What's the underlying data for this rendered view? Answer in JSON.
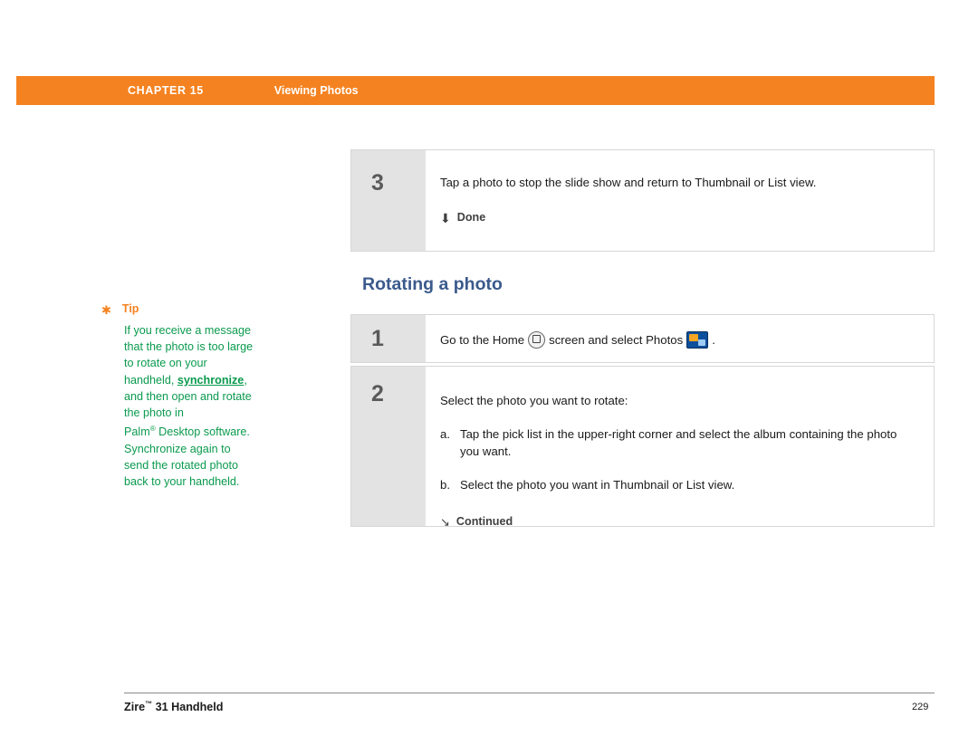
{
  "header": {
    "chapter": "CHAPTER 15",
    "section": "Viewing Photos"
  },
  "tip": {
    "label": "Tip",
    "star_icon": "asterisk-icon",
    "line1": "If you receive a message",
    "line2": "that the photo is too large",
    "line3": "to rotate on your",
    "line4_prefix": "handheld, ",
    "line4_link": "synchronize",
    "line4_suffix": ",",
    "line5": "and then open and rotate",
    "line6": "the photo in",
    "line7": "Palm",
    "line7_sup": "®",
    "line7_rest": " Desktop software.",
    "line8": "Synchronize again to",
    "line9": "send the rotated photo",
    "line10": "back to your handheld."
  },
  "steps": {
    "step3": {
      "number": "3",
      "text": "Tap a photo to stop the slide show and return to Thumbnail or List view.",
      "done_icon": "down-arrow-icon",
      "done_label": "Done"
    },
    "heading": "Rotating a photo",
    "step1": {
      "number": "1",
      "text_before": "Go to the Home",
      "home_icon": "home-icon",
      "text_middle": "screen and select Photos",
      "photos_icon": "photos-app-icon",
      "text_after": "."
    },
    "step2": {
      "number": "2",
      "text": "Select the photo you want to rotate:",
      "sub_a_letter": "a.",
      "sub_a_text": "Tap the pick list in the upper-right corner and select the album containing the photo you want.",
      "sub_b_letter": "b.",
      "sub_b_text": "Select the photo you want in Thumbnail or List view.",
      "continued_icon": "continued-arrow-icon",
      "continued_label": "Continued"
    }
  },
  "footer": {
    "product": "Zire",
    "product_sup": "™",
    "product_rest": " 31 Handheld",
    "page_number": "229"
  },
  "colors": {
    "header_orange": "#f58220",
    "tip_green": "#0a9a4e",
    "heading_blue": "#3b5a8c",
    "table_border_gray": "#d7d7d7"
  }
}
